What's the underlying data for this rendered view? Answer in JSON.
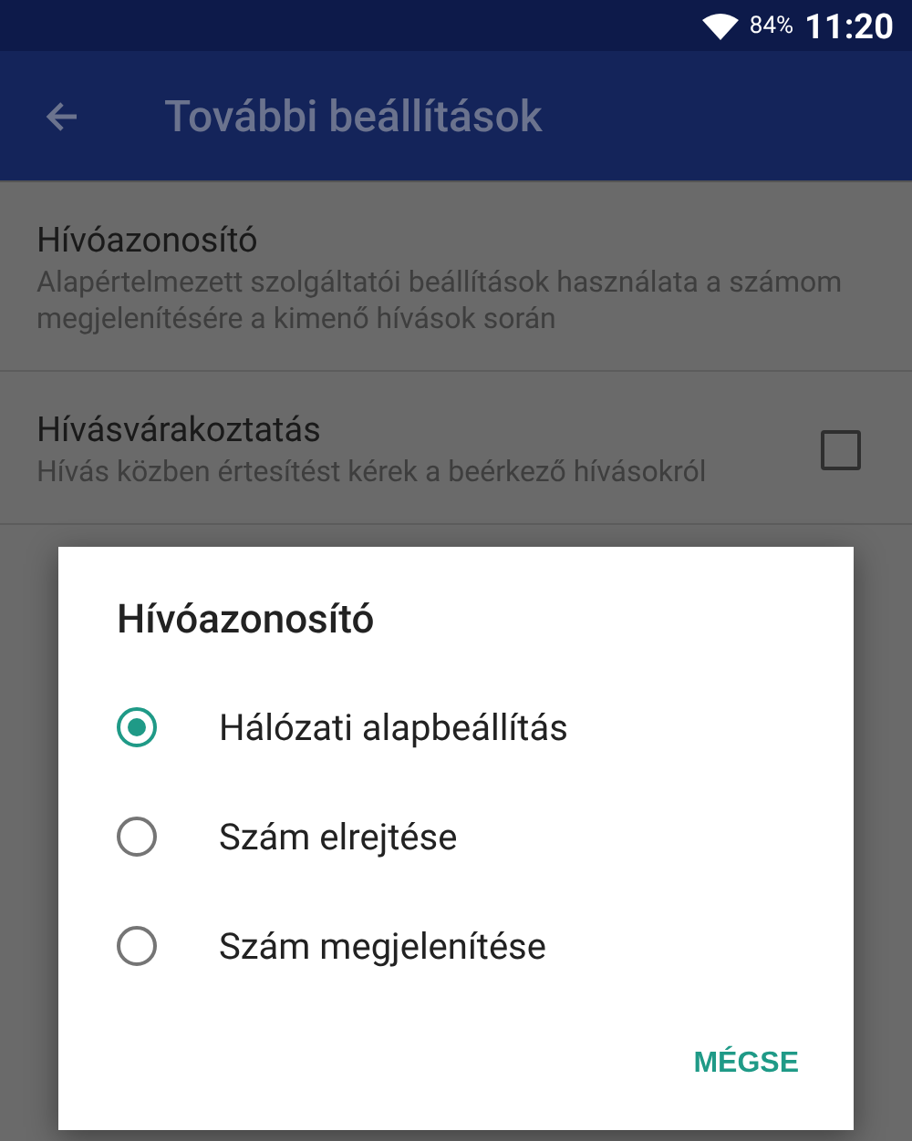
{
  "status_bar": {
    "battery": "84%",
    "time": "11:20"
  },
  "app_bar": {
    "title": "További beállítások"
  },
  "settings": [
    {
      "kind": "plain",
      "title": "Hívóazonosító",
      "summary": "Alapértelmezett szolgáltatói beállítások használata a számom megjelenítésére a kimenő hívások során"
    },
    {
      "kind": "checkbox",
      "title": "Hívásvárakoztatás",
      "summary": "Hívás közben értesítést kérek a beérkező hívásokról",
      "checked": false
    }
  ],
  "dialog": {
    "title": "Hívóazonosító",
    "options": [
      {
        "label": "Hálózati alapbeállítás",
        "selected": true
      },
      {
        "label": "Szám elrejtése",
        "selected": false
      },
      {
        "label": "Szám megjelenítése",
        "selected": false
      }
    ],
    "buttons": [
      "MÉGSE"
    ]
  }
}
